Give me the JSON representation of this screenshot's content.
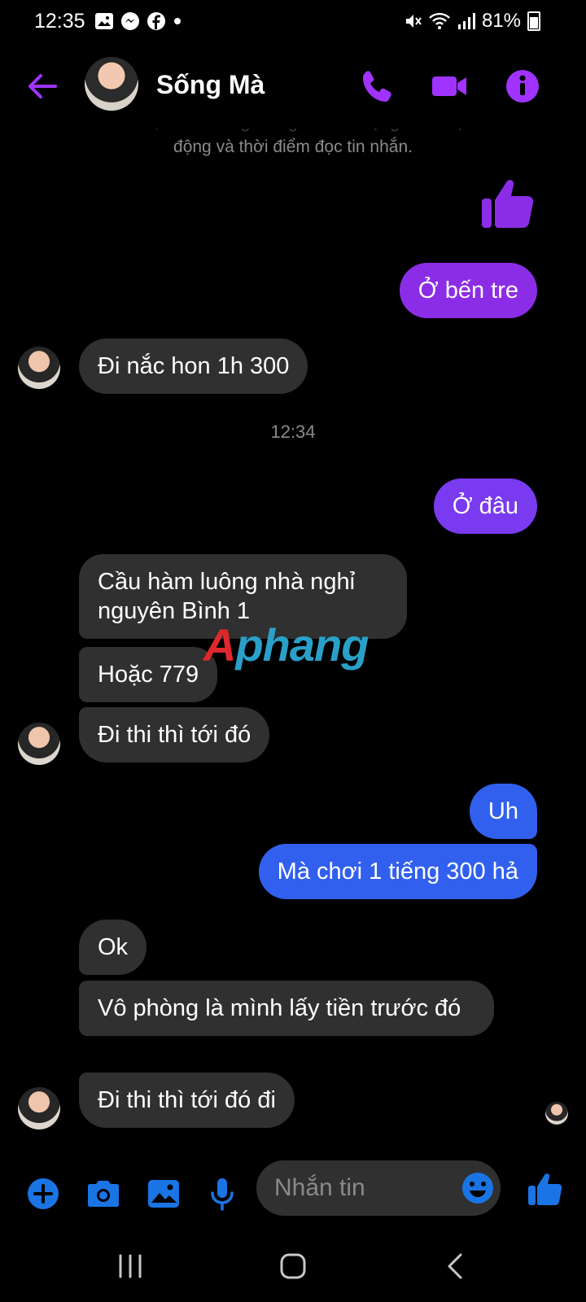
{
  "status_bar": {
    "time": "12:35",
    "battery": "81%",
    "icons": [
      "gallery-icon",
      "messenger-icon",
      "facebook-icon",
      "dot-icon",
      "mute-icon",
      "wifi-icon",
      "signal-icon",
      "battery-icon"
    ]
  },
  "header": {
    "contact_name": "Sống Mà",
    "icons": [
      "back-arrow-icon",
      "phone-icon",
      "video-camera-icon",
      "info-icon"
    ],
    "accent": "#a033ff"
  },
  "info_text": {
    "line1": "nhau, xem những thông tin như trạng thái hoạt",
    "line2": "động và thời điểm đọc tin nhắn."
  },
  "messages": [
    {
      "from": "me",
      "text": "Ở bến tre"
    },
    {
      "from": "them",
      "text": "Đi nắc hon 1h 300"
    },
    {
      "type": "timestamp",
      "text": "12:34"
    },
    {
      "from": "me",
      "text": "Ở đâu"
    },
    {
      "from": "them",
      "text": "Cầu hàm luông nhà nghỉ nguyên Bình 1"
    },
    {
      "from": "them",
      "text": "Hoặc 779"
    },
    {
      "from": "them",
      "text": "Đi thi thì tới đó"
    },
    {
      "from": "me",
      "text": "Uh"
    },
    {
      "from": "me",
      "text": "Mà chơi 1 tiếng 300 hả"
    },
    {
      "from": "them",
      "text": "Ok"
    },
    {
      "from": "them",
      "text": "Vô phòng là mình lấy tiền trước đó"
    },
    {
      "from": "them",
      "text": "Đi thi thì tới đó đi"
    }
  ],
  "watermark": {
    "part1": "A",
    "part2": "phang"
  },
  "composer": {
    "placeholder": "Nhắn tin",
    "icons": [
      "plus-icon",
      "camera-icon",
      "image-icon",
      "microphone-icon",
      "emoji-icon",
      "thumbs-up-icon"
    ],
    "accent": "#1b74e4"
  },
  "nav": {
    "icons": [
      "recent-apps-icon",
      "home-icon",
      "back-icon"
    ]
  }
}
